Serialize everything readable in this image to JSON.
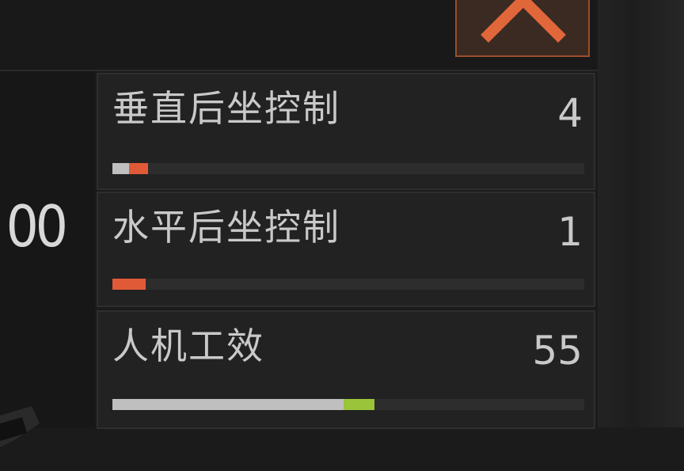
{
  "close_button": {
    "icon": "close-x-icon",
    "accent": "#e0673a"
  },
  "left_panel": {
    "value_partial": "00"
  },
  "stats": [
    {
      "label": "垂直后坐控制",
      "value": "4",
      "bar_base": 0.035,
      "bar_delta": 0.04,
      "delta_color": "#e05a38"
    },
    {
      "label": "水平后坐控制",
      "value": "1",
      "bar_base": 0.0,
      "bar_delta": 0.07,
      "delta_color": "#e05a38"
    },
    {
      "label": "人机工效",
      "value": "55",
      "bar_base": 0.49,
      "bar_delta": 0.065,
      "delta_color": "#9ac43a"
    }
  ]
}
